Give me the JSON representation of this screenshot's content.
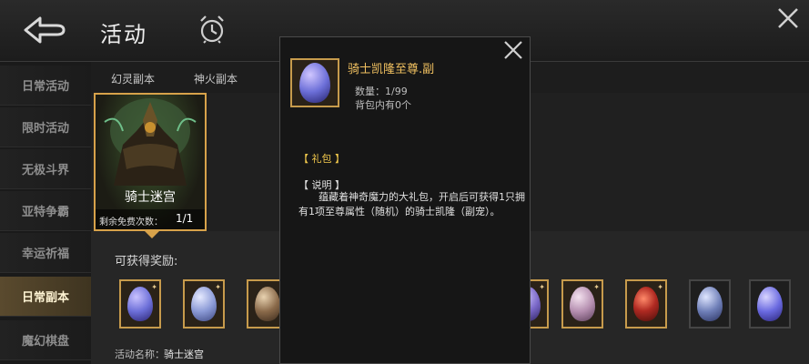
{
  "header": {
    "title": "活动"
  },
  "sidebar": {
    "items": [
      {
        "label": "日常活动",
        "badge": true,
        "active": false
      },
      {
        "label": "限时活动",
        "badge": false,
        "active": false
      },
      {
        "label": "无极斗界",
        "badge": false,
        "active": false
      },
      {
        "label": "亚特争霸",
        "badge": false,
        "active": false
      },
      {
        "label": "幸运祈福",
        "badge": false,
        "active": false
      },
      {
        "label": "日常副本",
        "badge": true,
        "active": true
      },
      {
        "label": "魔幻棋盘",
        "badge": true,
        "active": false
      }
    ]
  },
  "tabs": [
    "幻灵副本",
    "神火副本"
  ],
  "card": {
    "name": "骑士迷宫",
    "free_label": "剩余免费次数：",
    "free_count": "1/1"
  },
  "rewards": {
    "label": "可获得奖励:",
    "items": [
      {
        "icon": "purple-egg-icon",
        "color": "#6c6fd8"
      },
      {
        "icon": "blue-egg-icon",
        "color": "#8b9ad6"
      },
      {
        "icon": "amber-egg-icon",
        "color": "#8a6a4a"
      },
      {
        "icon": "purple-egg-icon",
        "color": "#7a68c8"
      },
      {
        "icon": "pink-egg-icon",
        "color": "#b58fb0"
      },
      {
        "icon": "red-egg-icon",
        "color": "#b02a22"
      },
      {
        "icon": "blue-egg-icon",
        "color": "#6f7fb8"
      },
      {
        "icon": "violet-egg-icon",
        "color": "#6a6ae0"
      }
    ]
  },
  "activity": {
    "name_label": "活动名称：",
    "name_value": "骑士迷宫"
  },
  "popup": {
    "item_name": "骑士凯隆至尊.副",
    "quantity": "数量：1/99",
    "bag": "背包内有0个",
    "gift_tag": "【 礼包 】",
    "desc_head": "【 说明 】",
    "desc_body": "蕴藏着神奇魔力的大礼包，开启后可获得1只拥有1项至尊属性（随机）的骑士凯隆（副宠）。"
  },
  "colors": {
    "gold": "#d7a24a",
    "accent_text": "#f0c060",
    "badge_red": "#e23b2b"
  }
}
